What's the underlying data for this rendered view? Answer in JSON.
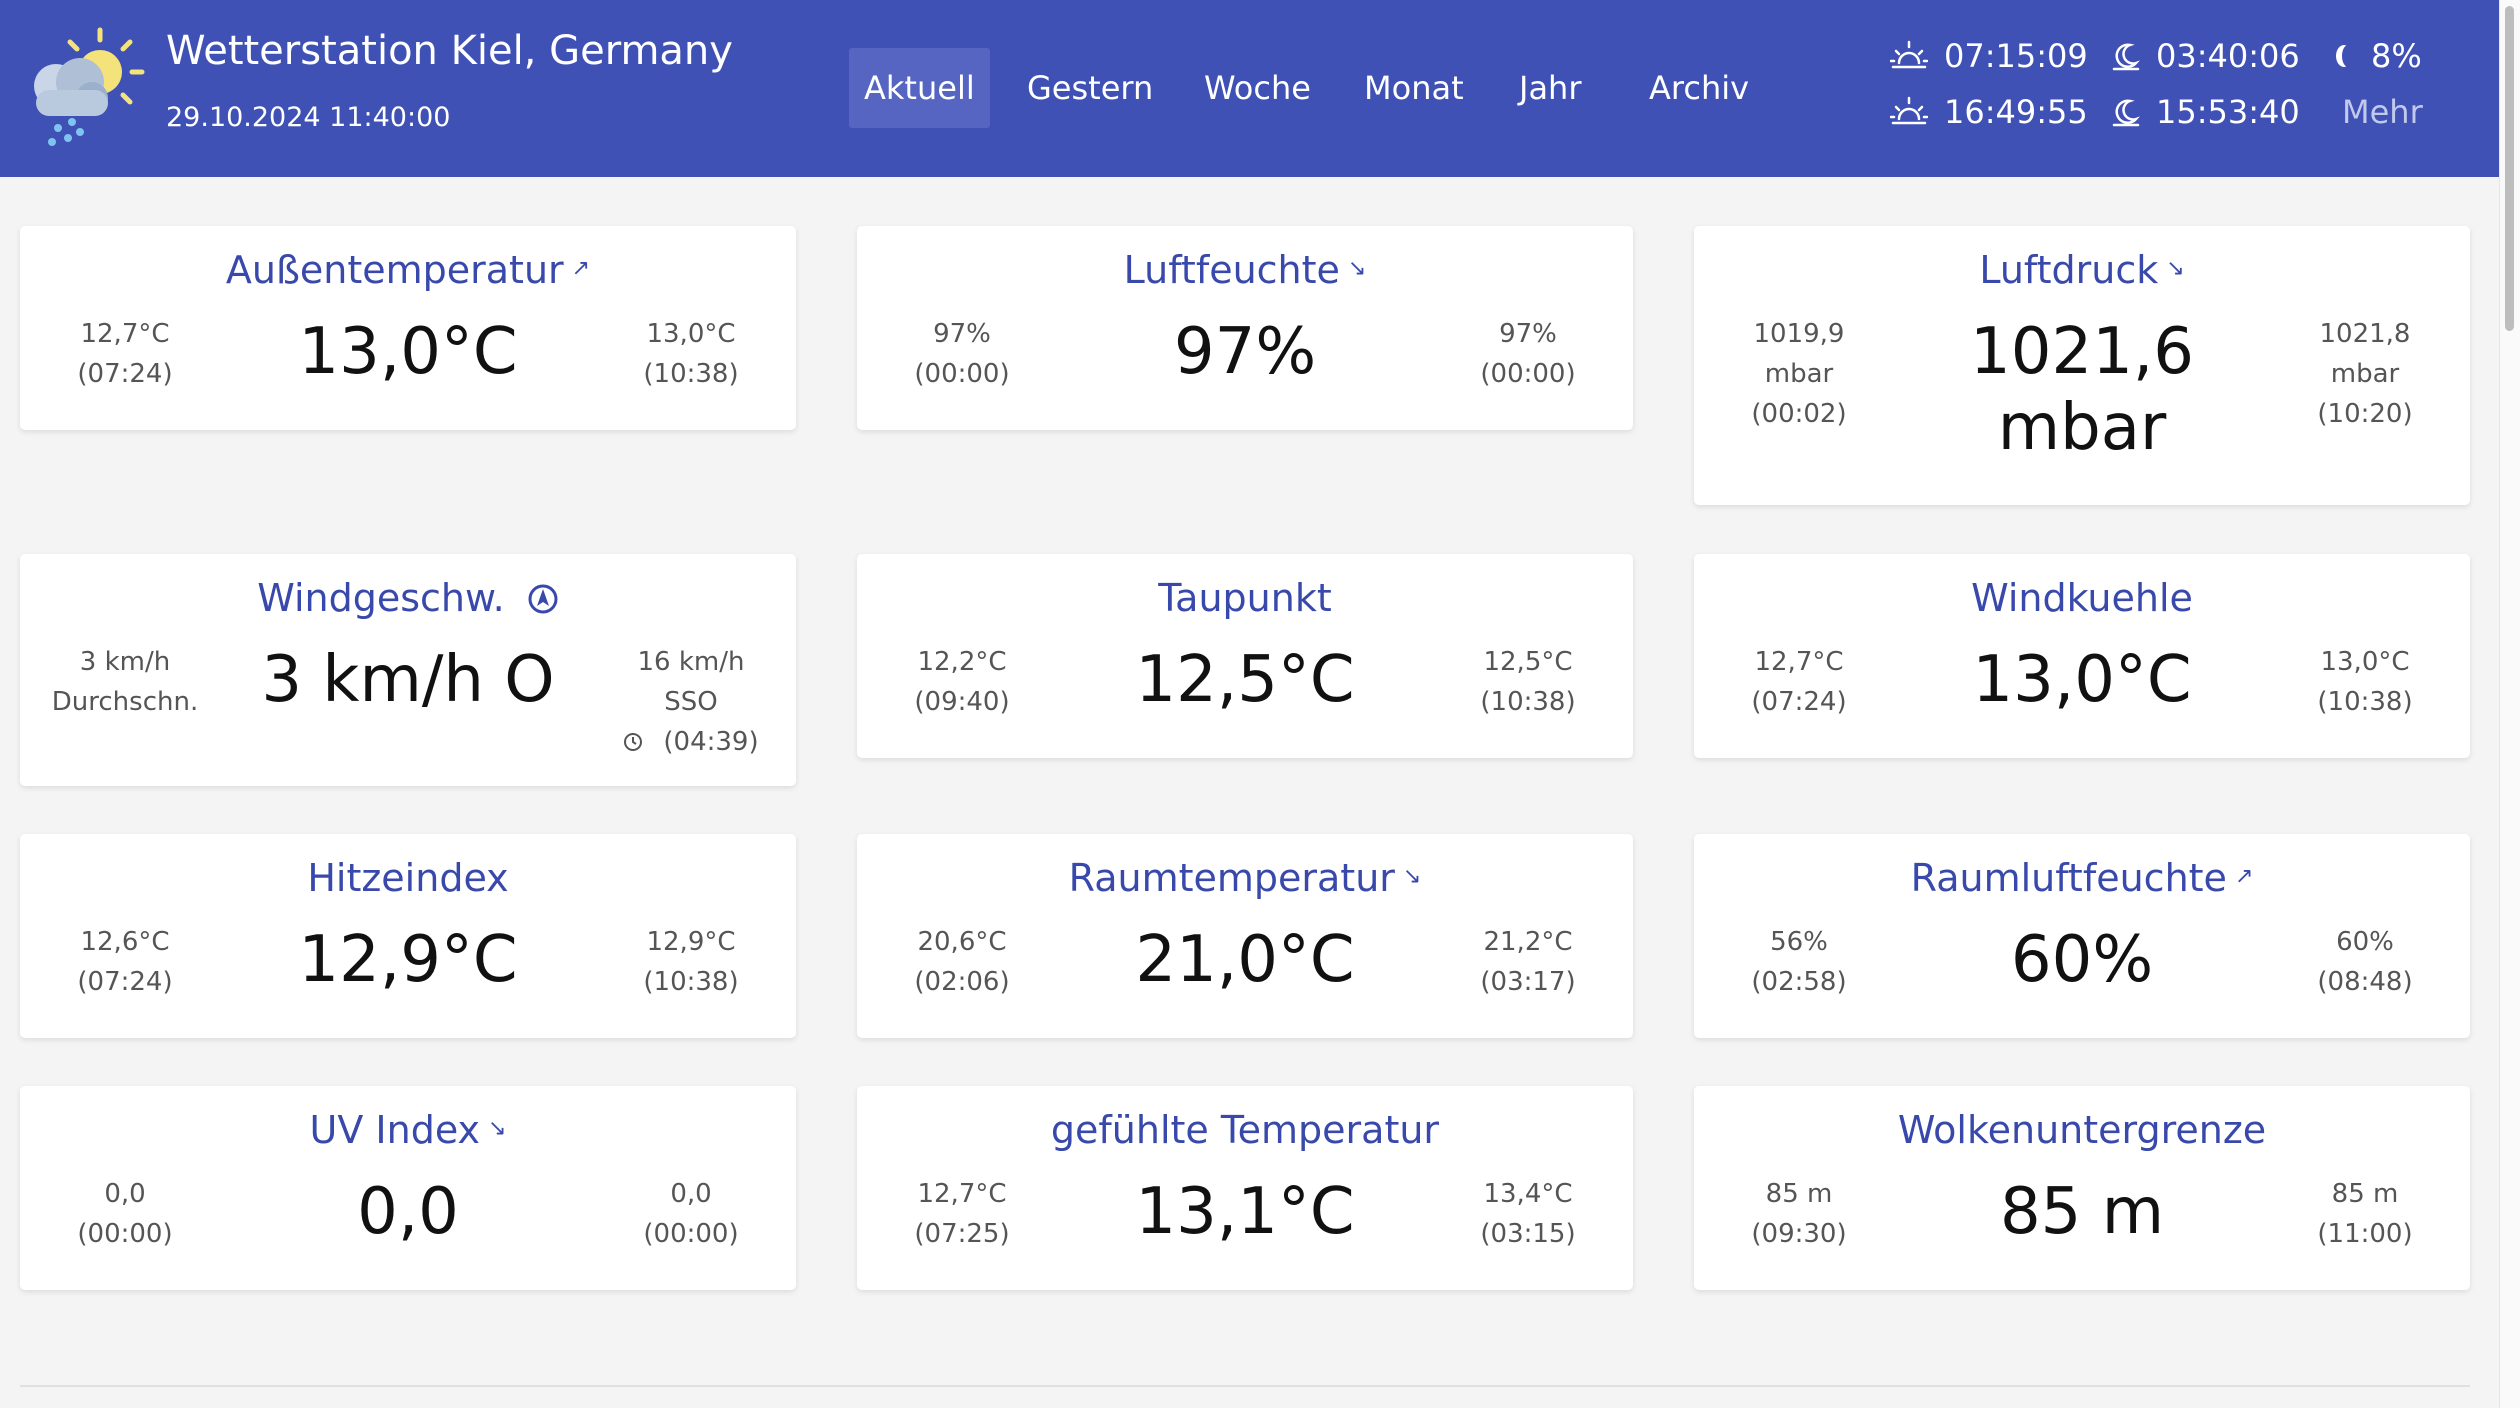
{
  "header": {
    "title": "Wetterstation Kiel, Germany",
    "datetime": "29.10.2024 11:40:00",
    "logo_icon": "cloud-sun-rain-icon",
    "colors": {
      "background": "#3f51b5",
      "active_nav": "#5565c1"
    }
  },
  "nav": {
    "items": [
      {
        "label": "Aktuell",
        "active": true
      },
      {
        "label": "Gestern"
      },
      {
        "label": "Woche"
      },
      {
        "label": "Monat"
      },
      {
        "label": "Jahr"
      },
      {
        "label": "Archiv"
      }
    ]
  },
  "astro": {
    "sunrise": "07:15:09",
    "sunset": "16:49:55",
    "moonrise": "03:40:06",
    "moonset": "15:53:40",
    "moon_phase": "8%",
    "more_label": "Mehr"
  },
  "cards": [
    {
      "title": "Außentemperatur",
      "trend": "↗",
      "value": "13,0°C",
      "min_value": "12,7°C",
      "min_time": "(07:24)",
      "max_value": "13,0°C",
      "max_time": "(10:38)"
    },
    {
      "title": "Luftfeuchte",
      "trend": "↘",
      "value": "97%",
      "min_value": "97%",
      "min_time": "(00:00)",
      "max_value": "97%",
      "max_time": "(00:00)"
    },
    {
      "title": "Luftdruck",
      "trend": "↘",
      "value_line1": "1021,6",
      "value_line2": "mbar",
      "min_value": "1019,9",
      "min_unit": "mbar",
      "min_time": "(00:02)",
      "max_value": "1021,8",
      "max_unit": "mbar",
      "max_time": "(10:20)"
    },
    {
      "title": "Windgeschw.",
      "title_icon": "compass-icon",
      "value": "3 km/h O",
      "left_line1": "3 km/h",
      "left_line2": "Durchschn.",
      "right_line1": "16 km/h",
      "right_line2": "SSO",
      "right_time": "(04:39)",
      "time_icon": "clock-icon"
    },
    {
      "title": "Taupunkt",
      "value": "12,5°C",
      "min_value": "12,2°C",
      "min_time": "(09:40)",
      "max_value": "12,5°C",
      "max_time": "(10:38)"
    },
    {
      "title": "Windkuehle",
      "value": "13,0°C",
      "min_value": "12,7°C",
      "min_time": "(07:24)",
      "max_value": "13,0°C",
      "max_time": "(10:38)"
    },
    {
      "title": "Hitzeindex",
      "value": "12,9°C",
      "min_value": "12,6°C",
      "min_time": "(07:24)",
      "max_value": "12,9°C",
      "max_time": "(10:38)"
    },
    {
      "title": "Raumtemperatur",
      "trend": "↘",
      "value": "21,0°C",
      "min_value": "20,6°C",
      "min_time": "(02:06)",
      "max_value": "21,2°C",
      "max_time": "(03:17)"
    },
    {
      "title": "Raumluftfeuchte",
      "trend": "↗",
      "value": "60%",
      "min_value": "56%",
      "min_time": "(02:58)",
      "max_value": "60%",
      "max_time": "(08:48)"
    },
    {
      "title": "UV Index",
      "trend": "↘",
      "value": "0,0",
      "min_value": "0,0",
      "min_time": "(00:00)",
      "max_value": "0,0",
      "max_time": "(00:00)"
    },
    {
      "title": "gefühlte Temperatur",
      "value": "13,1°C",
      "min_value": "12,7°C",
      "min_time": "(07:25)",
      "max_value": "13,4°C",
      "max_time": "(03:15)"
    },
    {
      "title": "Wolkenuntergrenze",
      "value": "85 m",
      "min_value": "85 m",
      "min_time": "(09:30)",
      "max_value": "85 m",
      "max_time": "(11:00)"
    }
  ]
}
